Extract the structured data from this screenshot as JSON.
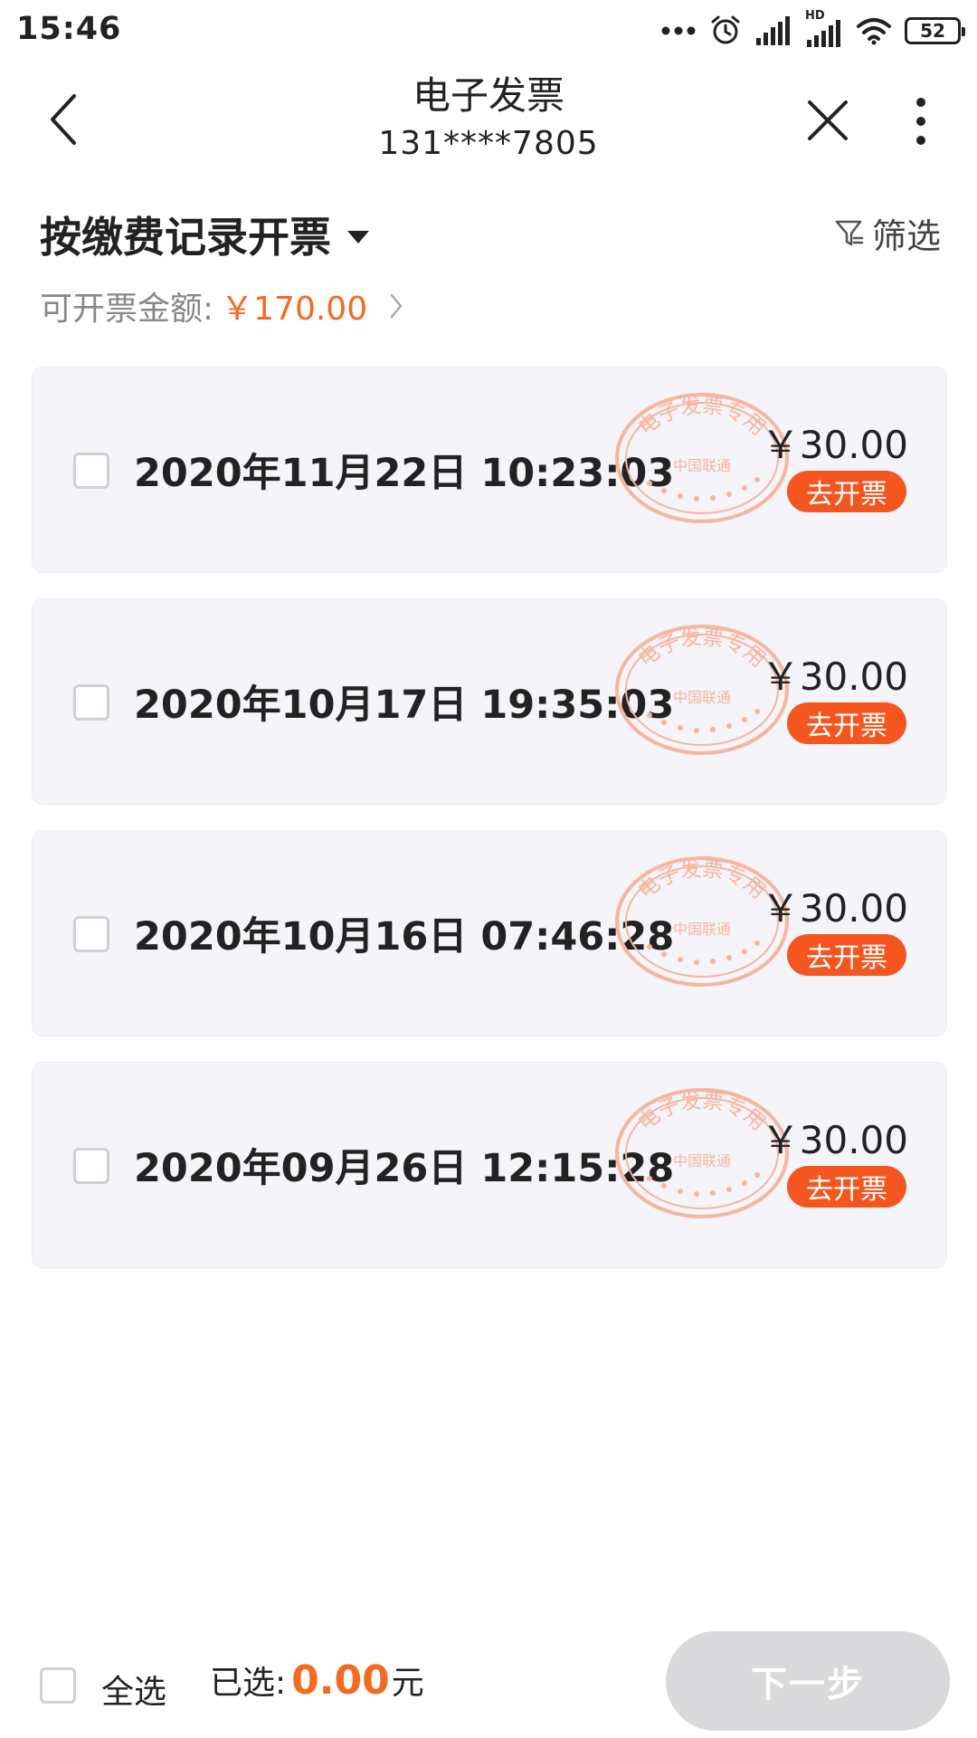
{
  "status_bar": {
    "time": "15:46",
    "battery": "52",
    "hd_label": "HD"
  },
  "header": {
    "title": "电子发票",
    "subtitle": "131****7805"
  },
  "mode": {
    "title": "按缴费记录开票"
  },
  "filter": {
    "label": "筛选"
  },
  "invoiceable": {
    "label": "可开票金额:",
    "amount": "￥170.00"
  },
  "stamp": {
    "top_text": "电子发票专用",
    "middle_text": "中国联通"
  },
  "records": [
    {
      "date": "2020年11月22日 10:23:03",
      "amount": "￥30.00",
      "action": "去开票"
    },
    {
      "date": "2020年10月17日 19:35:03",
      "amount": "￥30.00",
      "action": "去开票"
    },
    {
      "date": "2020年10月16日 07:46:28",
      "amount": "￥30.00",
      "action": "去开票"
    },
    {
      "date": "2020年09月26日 12:15:28",
      "amount": "￥30.00",
      "action": "去开票"
    }
  ],
  "footer": {
    "select_all": "全选",
    "selected_label": "已选:",
    "selected_amount": "0.00",
    "selected_unit": "元",
    "next_button": "下一步"
  },
  "colors": {
    "accent": "#f26b21",
    "button": "#f5561f",
    "card_bg": "#f4f4f9",
    "disabled_button": "#d9d9dc",
    "stamp": "#f6b59e"
  },
  "icons": {
    "back": "chevron-left-icon",
    "close": "close-icon",
    "more": "more-vertical-icon",
    "filter": "filter-icon",
    "caret": "caret-down-icon",
    "arrow": "chevron-right-icon"
  }
}
